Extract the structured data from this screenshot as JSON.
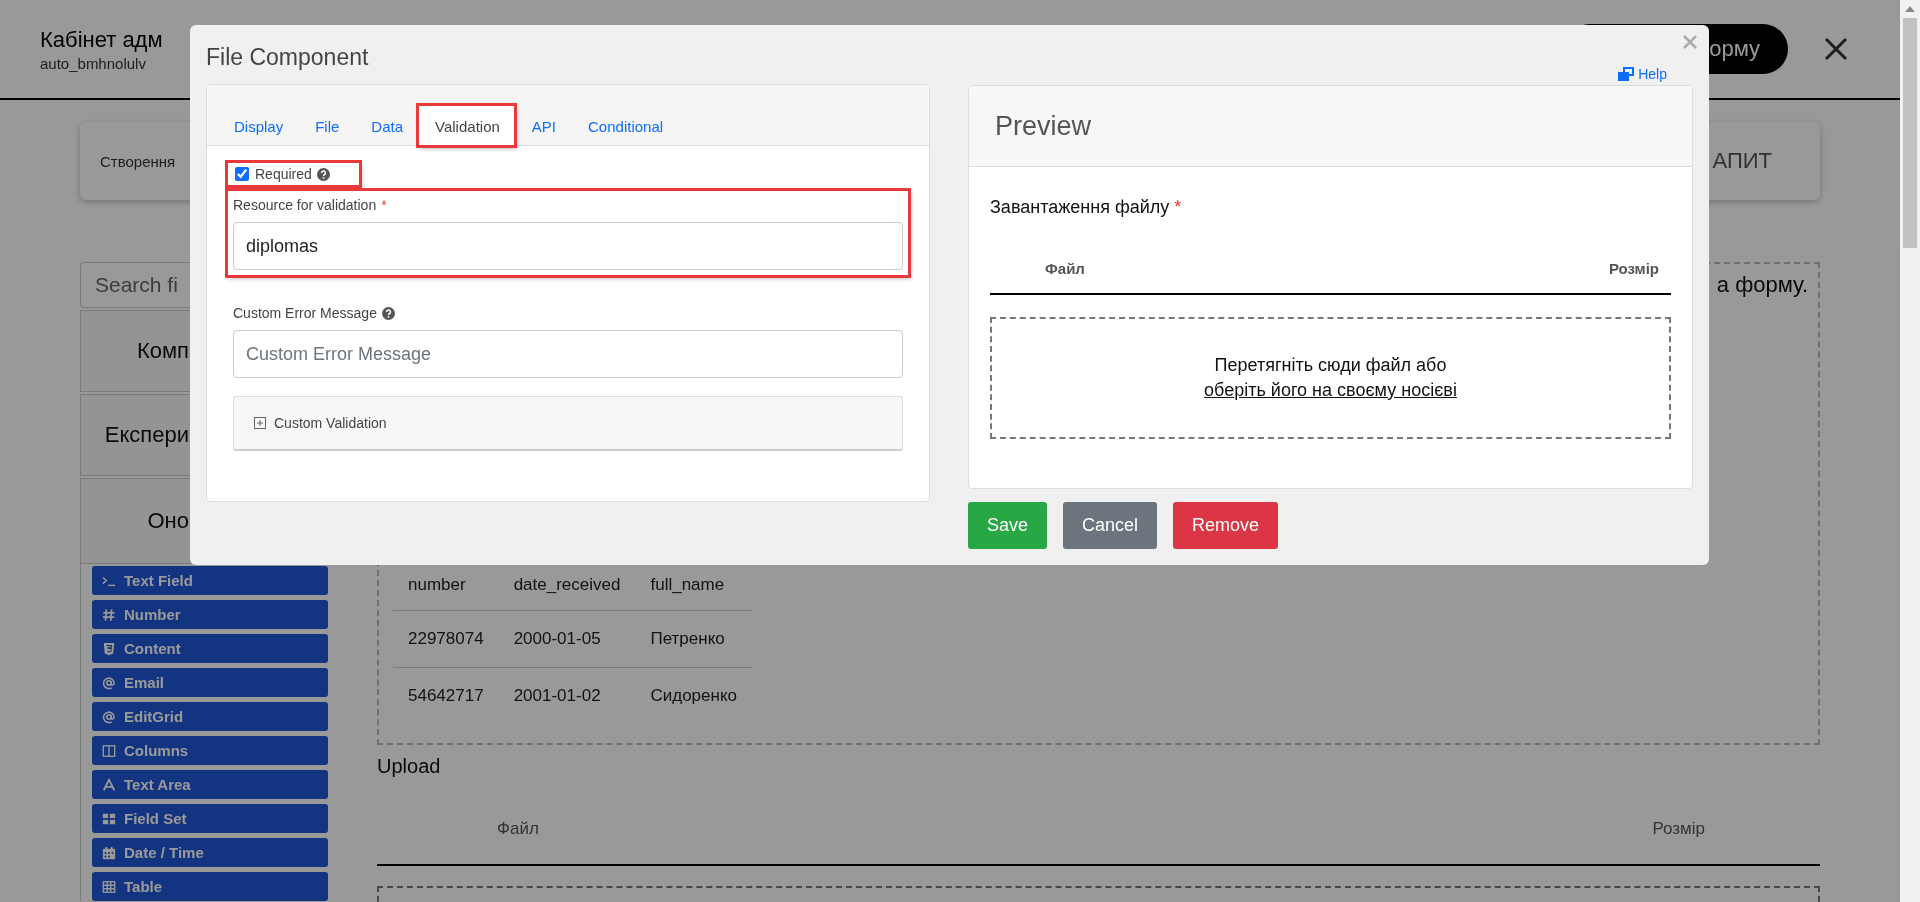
{
  "header": {
    "title": "Кабінет адм",
    "subtitle": "auto_bmhnolulv",
    "action_button": "орму"
  },
  "toolbar_card": {
    "left_text": "Створення",
    "right_text": "АПИТ"
  },
  "sidebar": {
    "search": {
      "placeholder": "Search fi"
    },
    "sections": [
      {
        "label": "Комп"
      },
      {
        "label": "Експери"
      },
      {
        "label": "Оно"
      }
    ],
    "components": [
      {
        "label": "Text Field",
        "kind": "terminal"
      },
      {
        "label": "Number",
        "kind": "hash"
      },
      {
        "label": "Content",
        "kind": "html5"
      },
      {
        "label": "Email",
        "kind": "at"
      },
      {
        "label": "EditGrid",
        "kind": "at"
      },
      {
        "label": "Columns",
        "kind": "columns"
      },
      {
        "label": "Text Area",
        "kind": "letter"
      },
      {
        "label": "Field Set",
        "kind": "grid"
      },
      {
        "label": "Date / Time",
        "kind": "calendar"
      },
      {
        "label": "Table",
        "kind": "table"
      }
    ]
  },
  "content": {
    "notice_text": "а форму.",
    "table": {
      "columns": [
        "number",
        "date_received",
        "full_name"
      ],
      "rows": [
        [
          "22978074",
          "2000-01-05",
          "Петренко"
        ],
        [
          "54642717",
          "2001-01-02",
          "Сидоренко"
        ]
      ]
    },
    "upload": {
      "label": "Upload",
      "columns": [
        "Файл",
        "Розмір"
      ]
    }
  },
  "modal": {
    "title": "File Component",
    "help": "Help",
    "tabs": [
      {
        "label": "Display",
        "selected": false,
        "highlighted": false
      },
      {
        "label": "File",
        "selected": false,
        "highlighted": false
      },
      {
        "label": "Data",
        "selected": false,
        "highlighted": false
      },
      {
        "label": "Validation",
        "selected": true,
        "highlighted": true
      },
      {
        "label": "API",
        "selected": false,
        "highlighted": false
      },
      {
        "label": "Conditional",
        "selected": false,
        "highlighted": false
      }
    ],
    "required": {
      "label": "Required",
      "checked": true,
      "highlighted": true
    },
    "resource_field": {
      "label": "Resource for validation",
      "required_mark": "*",
      "value": "diplomas",
      "highlighted": true
    },
    "error_field": {
      "label": "Custom Error Message",
      "placeholder": "Custom Error Message"
    },
    "custom_validation": {
      "label": "Custom Validation",
      "expanded": false
    },
    "preview": {
      "title": "Preview",
      "field_label": "Завантаження файлу",
      "required_mark": "*",
      "columns": [
        "Файл",
        "Розмір"
      ],
      "drop_text": "Перетягніть сюди файл або",
      "browse_link": "оберіть його на своєму носієві"
    },
    "buttons": [
      {
        "label": "Save",
        "kind": "success"
      },
      {
        "label": "Cancel",
        "kind": "secondary"
      },
      {
        "label": "Remove",
        "kind": "danger"
      }
    ]
  }
}
